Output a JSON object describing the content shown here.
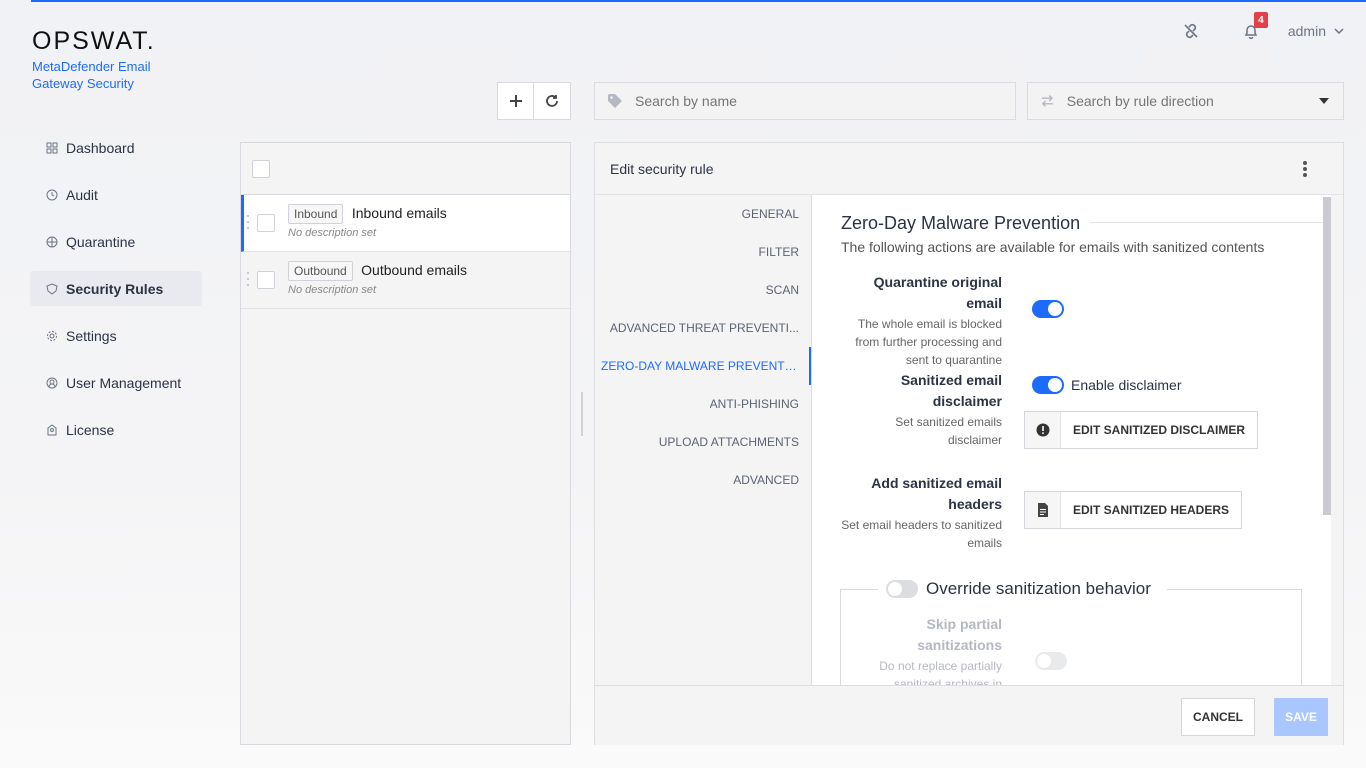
{
  "brand": {
    "logo": "OPSWAT.",
    "product": "MetaDefender Email Gateway Security"
  },
  "header": {
    "user": "admin",
    "notifications": "4"
  },
  "nav": [
    {
      "label": "Dashboard",
      "icon": "grid-icon"
    },
    {
      "label": "Audit",
      "icon": "audit-icon"
    },
    {
      "label": "Quarantine",
      "icon": "quarantine-icon"
    },
    {
      "label": "Security Rules",
      "icon": "shield-icon",
      "active": true
    },
    {
      "label": "Settings",
      "icon": "gear-icon"
    },
    {
      "label": "User Management",
      "icon": "user-icon"
    },
    {
      "label": "License",
      "icon": "license-icon"
    }
  ],
  "search": {
    "name_placeholder": "Search by name",
    "direction_placeholder": "Search by rule direction"
  },
  "rules": [
    {
      "tag": "Inbound",
      "name": "Inbound emails",
      "desc": "No description set"
    },
    {
      "tag": "Outbound",
      "name": "Outbound emails",
      "desc": "No description set"
    }
  ],
  "edit": {
    "title": "Edit security rule",
    "tabs": [
      "GENERAL",
      "FILTER",
      "SCAN",
      "ADVANCED THREAT PREVENTI...",
      "ZERO-DAY MALWARE PREVENTI...",
      "ANTI-PHISHING",
      "UPLOAD ATTACHMENTS",
      "ADVANCED"
    ],
    "section_title": "Zero-Day Malware Prevention",
    "section_sub": "The following actions are available for emails with sanitized contents",
    "quarantine": {
      "title": "Quarantine original email",
      "desc": "The whole email is blocked from further processing and sent to quarantine"
    },
    "disclaimer": {
      "title": "Sanitized email disclaimer",
      "desc": "Set sanitized emails disclaimer",
      "toggle_label": "Enable disclaimer",
      "button": "EDIT SANITIZED DISCLAIMER"
    },
    "headers": {
      "title": "Add sanitized email headers",
      "desc": "Set email headers to sanitized emails",
      "button": "EDIT SANITIZED HEADERS"
    },
    "override": {
      "label": "Override sanitization behavior"
    },
    "skip": {
      "title": "Skip partial sanitizations",
      "desc": "Do not replace partially sanitized archives in"
    },
    "cancel": "CANCEL",
    "save": "SAVE"
  }
}
